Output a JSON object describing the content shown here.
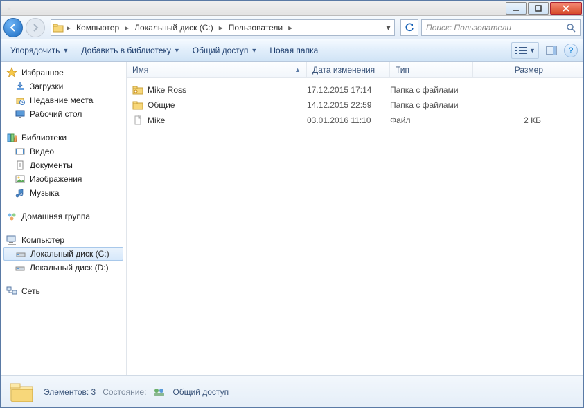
{
  "titlebar": {
    "blur_items": [
      "···",
      "···",
      "···",
      "···",
      "···"
    ]
  },
  "nav": {
    "breadcrumb": [
      "Компьютер",
      "Локальный диск (C:)",
      "Пользователи"
    ],
    "search_placeholder": "Поиск: Пользователи"
  },
  "toolbar": {
    "organize": "Упорядочить",
    "add_library": "Добавить в библиотеку",
    "share": "Общий доступ",
    "new_folder": "Новая папка"
  },
  "sidebar": {
    "favorites": {
      "label": "Избранное",
      "items": [
        "Загрузки",
        "Недавние места",
        "Рабочий стол"
      ]
    },
    "libraries": {
      "label": "Библиотеки",
      "items": [
        "Видео",
        "Документы",
        "Изображения",
        "Музыка"
      ]
    },
    "homegroup": {
      "label": "Домашняя группа"
    },
    "computer": {
      "label": "Компьютер",
      "items": [
        "Локальный диск (C:)",
        "Локальный диск (D:)"
      ],
      "selected_index": 0
    },
    "network": {
      "label": "Сеть"
    }
  },
  "columns": {
    "name": "Имя",
    "date": "Дата изменения",
    "type": "Тип",
    "size": "Размер"
  },
  "files": [
    {
      "icon": "folder-user",
      "name": "Mike Ross",
      "date": "17.12.2015 17:14",
      "type": "Папка с файлами",
      "size": ""
    },
    {
      "icon": "folder",
      "name": "Общие",
      "date": "14.12.2015 22:59",
      "type": "Папка с файлами",
      "size": ""
    },
    {
      "icon": "file",
      "name": "Mike",
      "date": "03.01.2016 11:10",
      "type": "Файл",
      "size": "2 КБ"
    }
  ],
  "status": {
    "count_label": "Элементов: 3",
    "state_label": "Состояние:",
    "share_label": "Общий доступ"
  }
}
